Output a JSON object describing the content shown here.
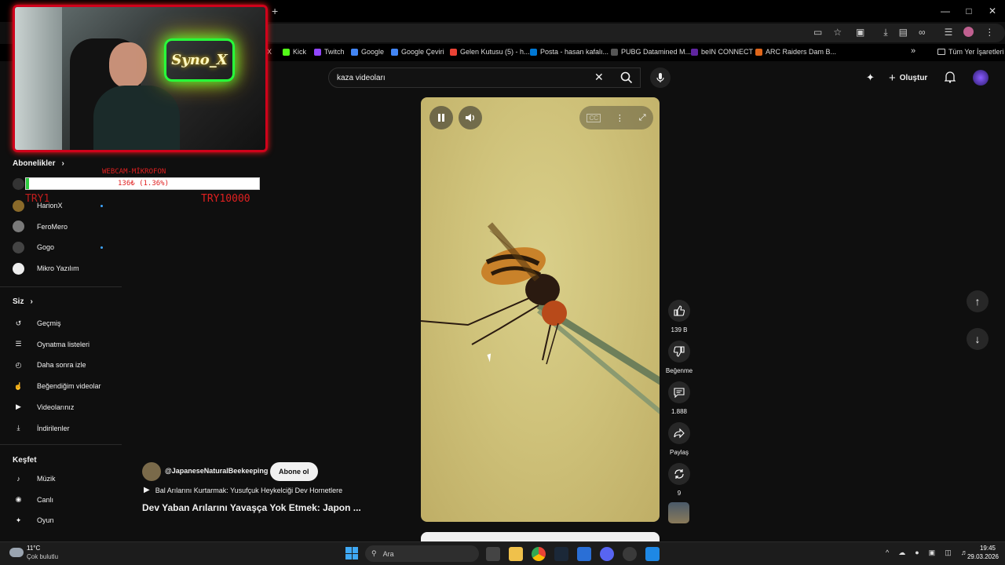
{
  "browser": {
    "new_tab_symbol": "+",
    "bookmarks": [
      {
        "label": "X",
        "color": "#ffffff"
      },
      {
        "label": "Kick",
        "color": "#53fc18"
      },
      {
        "label": "Twitch",
        "color": "#9146ff"
      },
      {
        "label": "Google",
        "color": "#4285f4"
      },
      {
        "label": "Google Çeviri",
        "color": "#4285f4"
      },
      {
        "label": "Gelen Kutusu (5) - h...",
        "color": "#ea4335"
      },
      {
        "label": "Posta - hasan kafalı...",
        "color": "#0078d4"
      },
      {
        "label": "PUBG Datamined M...",
        "color": "#555555"
      },
      {
        "label": "beIN CONNECT",
        "color": "#5f259f"
      },
      {
        "label": "ARC Raiders Dam B...",
        "color": "#e0661a"
      }
    ],
    "more_bookmarks": "»",
    "all_bookmarks": "Tüm Yer İşaretleri"
  },
  "youtube": {
    "search_value": "kaza videoları",
    "create_label": "Oluştur"
  },
  "sidebar": {
    "subscriptions_heading": "Abonelikler",
    "subscriptions": [
      {
        "label": "HarionX",
        "new": true,
        "avatar": "#8a6a2a"
      },
      {
        "label": "FeroMero",
        "new": false,
        "avatar": "#7a7a7a"
      },
      {
        "label": "Gogo",
        "new": true,
        "avatar": "#444444"
      },
      {
        "label": "Mikro Yazılım",
        "new": false,
        "avatar": "#eeeeee"
      }
    ],
    "you_heading": "Siz",
    "you_items": [
      {
        "label": "Geçmiş",
        "icon": "history-icon"
      },
      {
        "label": "Oynatma listeleri",
        "icon": "playlist-icon"
      },
      {
        "label": "Daha sonra izle",
        "icon": "clock-icon"
      },
      {
        "label": "Beğendiğim videolar",
        "icon": "thumbs-up-icon"
      },
      {
        "label": "Videolarınız",
        "icon": "video-icon"
      },
      {
        "label": "İndirilenler",
        "icon": "download-icon"
      }
    ],
    "explore_heading": "Keşfet",
    "explore_items": [
      {
        "label": "Müzik",
        "icon": "music-icon"
      },
      {
        "label": "Canlı",
        "icon": "live-icon"
      },
      {
        "label": "Oyun",
        "icon": "gaming-icon"
      }
    ]
  },
  "overlay": {
    "neon_sign": "Syno_X",
    "donation_title": "WEBCAM-MİKROFON",
    "donation_progress_text": "136₺ (1.36%)",
    "donation_progress": 0.0136,
    "donation_min": "TRY1",
    "donation_max": "TRY10000"
  },
  "short": {
    "channel": "@JapaneseNaturalBeekeeping",
    "subscribe_label": "Abone ol",
    "playlist_title": "Bal Arılarını Kurtarmak: Yusufçuk Heykelciği Dev Hornetlere",
    "title": "Dev Yaban Arılarını Yavaşça Yok Etmek: Japon ...",
    "likes": "139 B",
    "dislike_label": "Beğenme",
    "comments": "1.888",
    "share_label": "Paylaş",
    "remix_count": "9"
  },
  "taskbar": {
    "weather_temp": "11°C",
    "weather_desc": "Çok bulutlu",
    "search_placeholder": "Ara",
    "time": "19:45",
    "date": "29.03.2026"
  }
}
